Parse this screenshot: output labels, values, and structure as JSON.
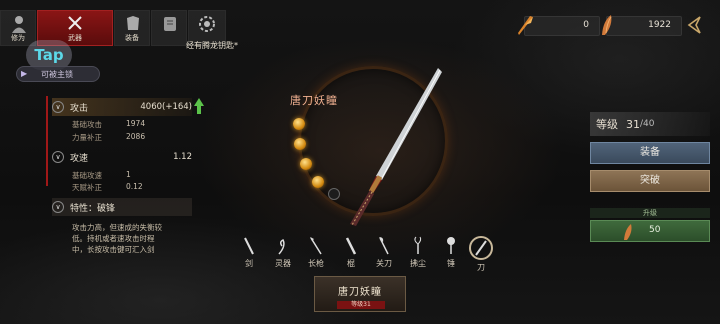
{
  "tabs": [
    {
      "label": "修为",
      "icon": "figure-icon"
    },
    {
      "label": "武器",
      "icon": "weapon-icon"
    },
    {
      "label": "装备",
      "icon": "armor-icon"
    },
    {
      "label": "",
      "icon": "scroll-icon"
    },
    {
      "label": "",
      "icon": "gear-ring-icon"
    }
  ],
  "notice": "经有腾龙钥匙*",
  "currencies": [
    {
      "value": "0",
      "icon": "feather-orange-icon"
    },
    {
      "value": "1922",
      "icon": "feather-gold-icon"
    }
  ],
  "tap_logo": "Tap",
  "unlock_label": "可被主锁",
  "stats": {
    "attack": {
      "name": "攻击",
      "value": "4060(+164)",
      "base_label": "基础攻击",
      "base_value": "1974",
      "power_label": "力量补正",
      "power_value": "2086"
    },
    "speed": {
      "name": "攻速",
      "value": "1.12",
      "base_label": "基础攻速",
      "base_value": "1",
      "talent_label": "天赋补正",
      "talent_value": "0.12"
    },
    "trait": {
      "name": "特性：破锋",
      "description": "攻击力高，但速成的失衡较低。持机或者速攻击时程中，长按攻击键可汇入剑"
    }
  },
  "weapon": {
    "name": "唐刀妖瞳",
    "level_badge": "等级31"
  },
  "weapon_types": [
    "剑",
    "灵器",
    "长枪",
    "棍",
    "关刀",
    "拂尘",
    "锤",
    "刀"
  ],
  "right_panel": {
    "level_label": "等级",
    "level_current": "31",
    "level_max": "/40",
    "equip_label": "装备",
    "break_label": "突破",
    "upgrade_label": "升级",
    "upgrade_cost": "50"
  },
  "colors": {
    "accent_red": "#8a1515",
    "equip_blue": "#51647a",
    "break_brown": "#8e7456",
    "upgrade_green": "#3f6a3c"
  }
}
